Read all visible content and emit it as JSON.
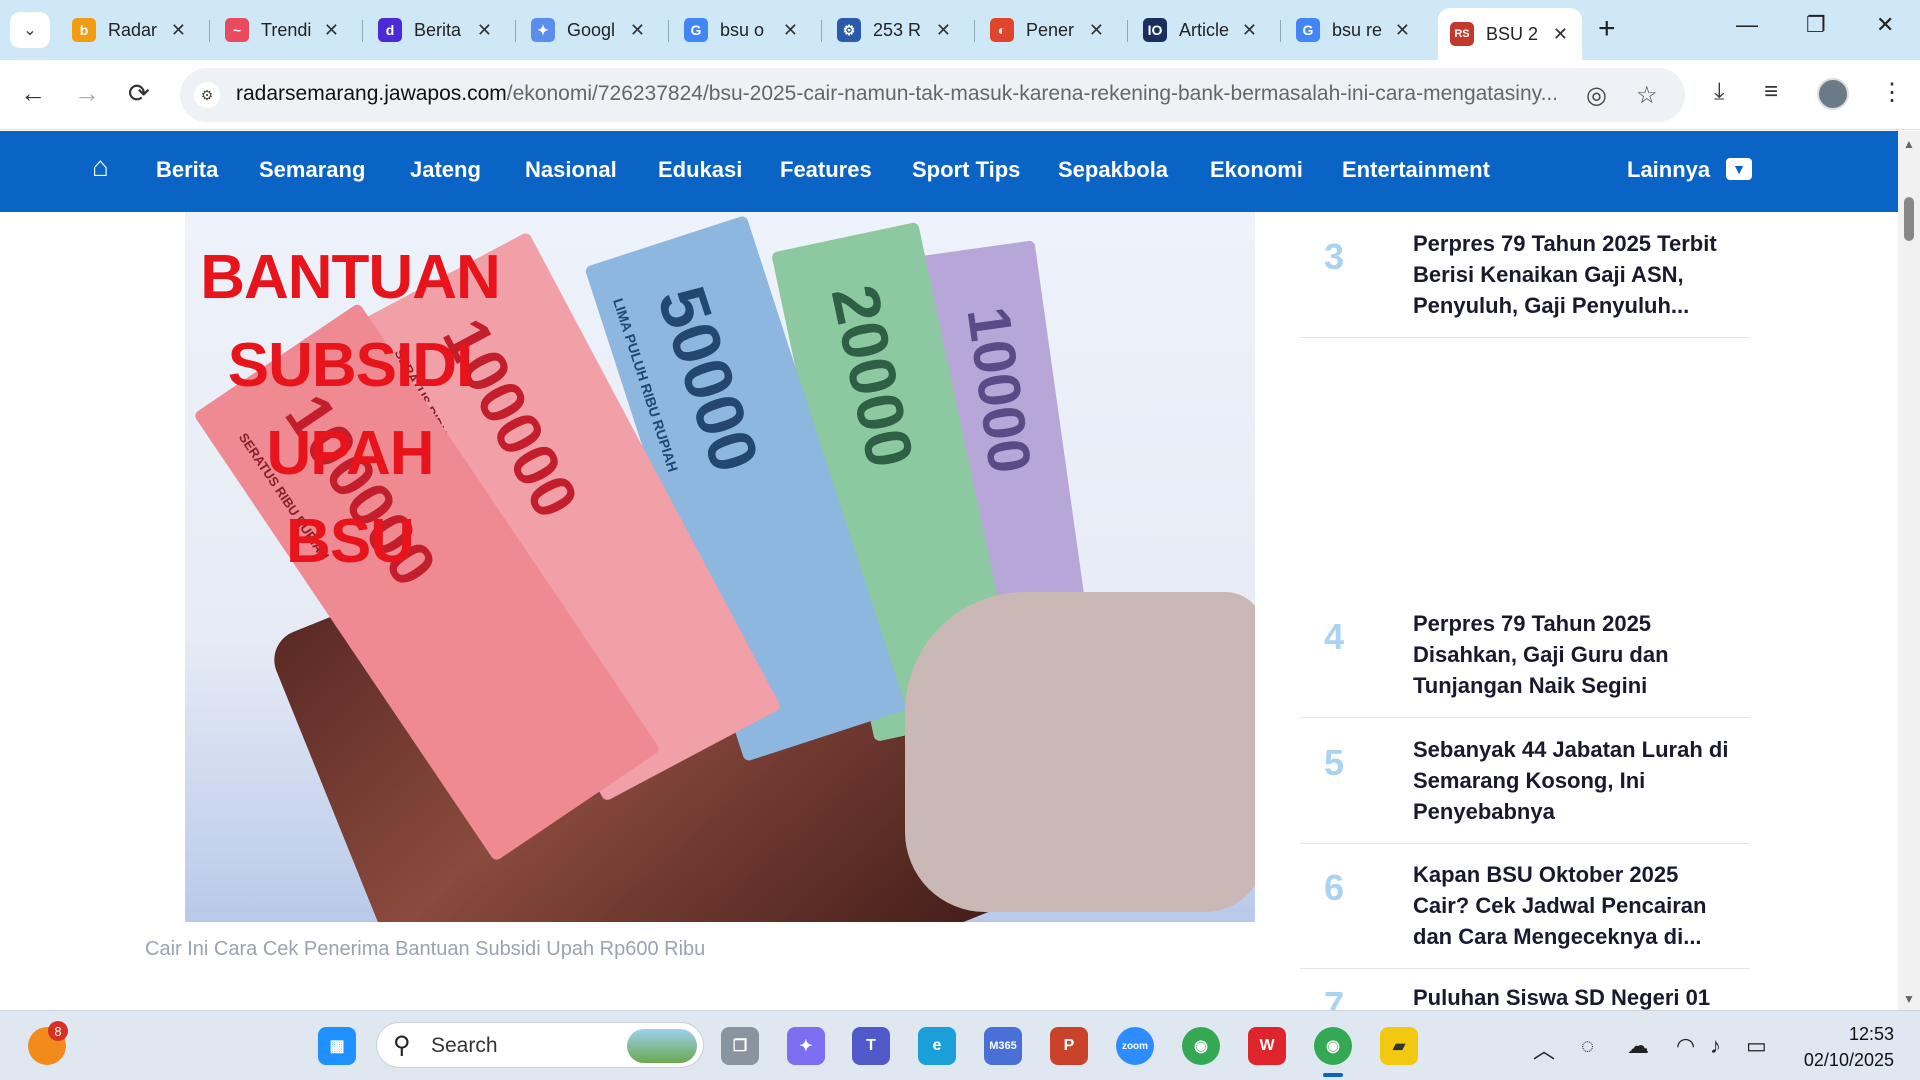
{
  "browser": {
    "tabs": [
      {
        "label": "Radar",
        "icon": "b"
      },
      {
        "label": "Trendi",
        "icon": "~"
      },
      {
        "label": "Berita",
        "icon": "d"
      },
      {
        "label": "Googl",
        "icon": "✦"
      },
      {
        "label": "bsu o",
        "icon": "G"
      },
      {
        "label": "253 R",
        "icon": "⚙"
      },
      {
        "label": "Pener",
        "icon": "◐"
      },
      {
        "label": "Article",
        "icon": "IO"
      },
      {
        "label": "bsu re",
        "icon": "G"
      },
      {
        "label": "BSU 2",
        "icon": "RS"
      }
    ],
    "url_host": "radarsemarang.jawapos.com",
    "url_path": "/ekonomi/726237824/bsu-2025-cair-namun-tak-masuk-karena-rekening-bank-bermasalah-ini-cara-mengatasiny..."
  },
  "site_nav": {
    "items": [
      "Berita",
      "Semarang",
      "Jateng",
      "Nasional",
      "Edukasi",
      "Features",
      "Sport Tips",
      "Sepakbola",
      "Ekonomi",
      "Entertainment"
    ],
    "more_label": "Lainnya"
  },
  "hero": {
    "headline_lines": [
      "BANTUAN",
      "SUBSIDI",
      "UPAH",
      "BSU"
    ],
    "notes": [
      "100000",
      "100000",
      "50000",
      "20000",
      "10000"
    ],
    "note_labels": [
      "SERATUS RIBU RUPIAH",
      "LIMA PULUH RIBU RUPIAH"
    ],
    "caption": "Cair Ini Cara Cek Penerima Bantuan Subsidi Upah Rp600 Ribu"
  },
  "trending": [
    {
      "num": "3",
      "title": "Perpres 79 Tahun 2025 Terbit Berisi Kenaikan Gaji ASN, Penyuluh, Gaji Penyuluh..."
    },
    {
      "num": "4",
      "title": "Perpres 79 Tahun 2025 Disahkan, Gaji Guru dan Tunjangan Naik Segini"
    },
    {
      "num": "5",
      "title": "Sebanyak 44 Jabatan Lurah di Semarang Kosong, Ini Penyebabnya"
    },
    {
      "num": "6",
      "title": "Kapan BSU Oktober 2025 Cair? Cek Jadwal Pencairan dan Cara Mengeceknya di..."
    },
    {
      "num": "7",
      "title": "Puluhan Siswa SD Negeri 01"
    }
  ],
  "taskbar": {
    "search_label": "Search",
    "notification_count": "8",
    "time": "12:53",
    "date": "02/10/2025",
    "app_labels": {
      "m365": "M365",
      "zoom": "zoom"
    }
  },
  "colors": {
    "site_nav_bg": "#0a64c6",
    "trend_num": "#a9d2f3",
    "headline_red": "#e8141b"
  }
}
